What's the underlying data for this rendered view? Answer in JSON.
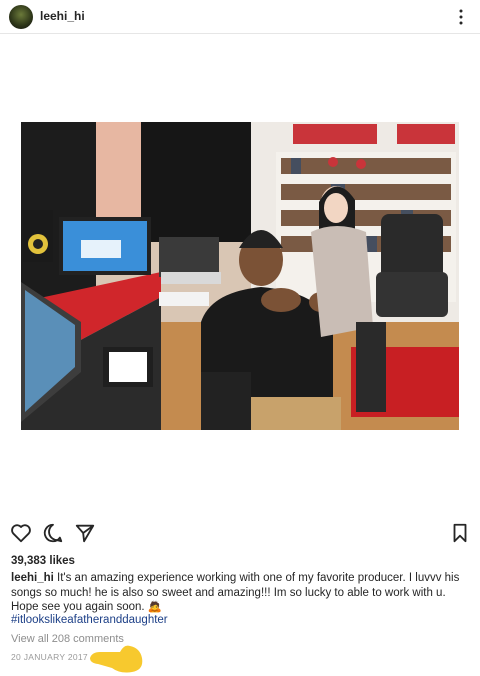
{
  "header": {
    "username": "leehi_hi",
    "menu_icon": "more-vertical-icon"
  },
  "post": {
    "image_description_icon": "studio-photo",
    "actions": {
      "like_icon": "heart-icon",
      "comment_icon": "comment-icon",
      "share_icon": "send-icon",
      "save_icon": "bookmark-icon"
    },
    "likes": "39,383 likes",
    "caption_user": "leehi_hi",
    "caption_text": " It's an amazing experience working with one of my favorite producer. I luvvv his songs so much! he is also so sweet and amazing!!! Im so lucky to able to work with u. Hope see you again soon. 🙇",
    "hashtag": "#itlookslikeafatheranddaughter",
    "view_comments": "View all 208 comments",
    "date": "20 JANUARY 2017"
  },
  "colors": {
    "link": "#1c3f87",
    "muted": "#8e8e8e",
    "divider": "#e6e6e6"
  }
}
